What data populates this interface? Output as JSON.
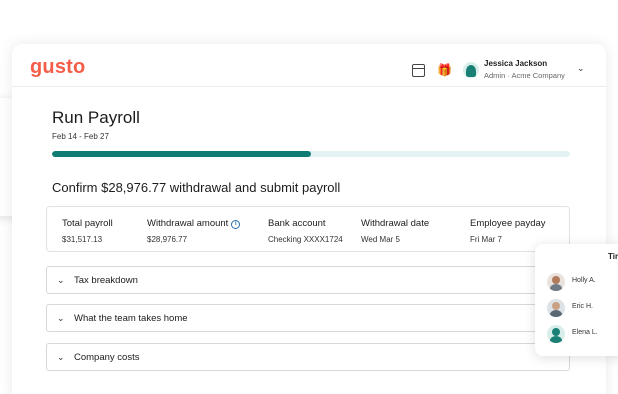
{
  "app": {
    "logo": "gusto"
  },
  "header": {
    "calendar_icon": "calendar-icon",
    "gift_icon": "gift-icon",
    "user": {
      "name": "Jessica Jackson",
      "role": "Admin · Acme Company"
    }
  },
  "page": {
    "title": "Run Payroll",
    "date_range": "Feb 14 - Feb 27",
    "progress_fraction": 0.5,
    "confirm_heading": "Confirm $28,976.77 withdrawal and submit payroll"
  },
  "summary": {
    "columns": [
      {
        "label": "Total payroll",
        "value": "$31,517.13"
      },
      {
        "label": "Withdrawal amount",
        "value": "$28,976.77",
        "info_icon": "info-icon"
      },
      {
        "label": "Bank account",
        "value": "Checking XXXX1724"
      },
      {
        "label": "Withdrawal date",
        "value": "Wed Mar 5"
      },
      {
        "label": "Employee payday",
        "value": "Fri Mar 7"
      }
    ]
  },
  "accordions": [
    {
      "label": "Tax breakdown"
    },
    {
      "label": "What the team takes home"
    },
    {
      "label": "Company costs"
    }
  ],
  "side_card": {
    "heading": "Tir",
    "people": [
      {
        "name": "Holly A."
      },
      {
        "name": "Eric H."
      },
      {
        "name": "Elena L."
      }
    ]
  },
  "colors": {
    "brand": "#f45d48",
    "accent": "#0f7c74",
    "track": "#e3f2f3"
  }
}
